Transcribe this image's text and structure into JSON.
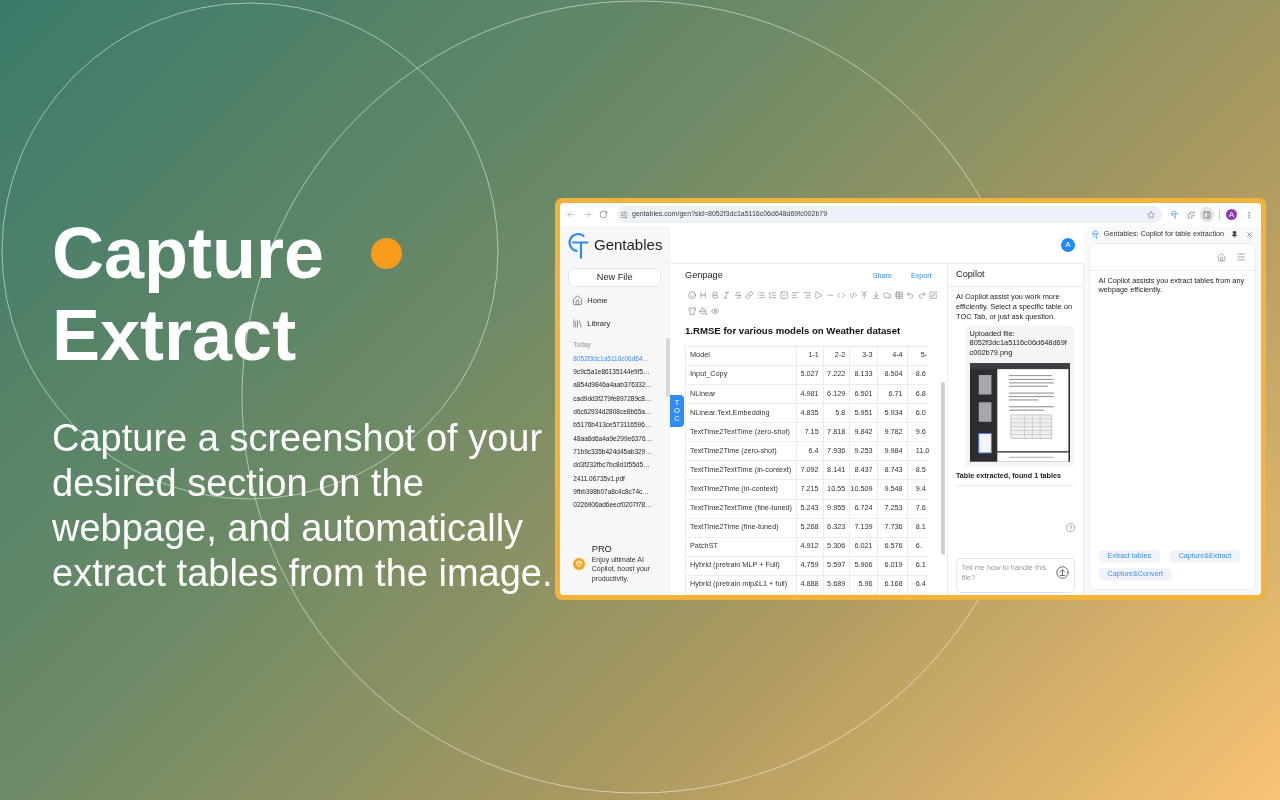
{
  "hero": {
    "title_lines": [
      "Capture",
      "Extract"
    ],
    "description": "Capture a screenshot of your desired section on the webpage, and automatically extract tables from the image."
  },
  "browser": {
    "url": "gentables.com/gen?sid=8052f3dc1a5116c06d648d69fc002b79",
    "profile_initial": "A"
  },
  "sidebar": {
    "logo_text": "Gentables",
    "new_file": "New File",
    "nav": [
      {
        "label": "Home"
      },
      {
        "label": "Library"
      }
    ],
    "history_heading": "Today",
    "history": [
      {
        "label": "8052f3dc1a5116c06d64…",
        "selected": true
      },
      {
        "label": "9c9c5a1e86135144e9f5…",
        "selected": false
      },
      {
        "label": "a854d9846a4aab376332…",
        "selected": false
      },
      {
        "label": "cad9dd3f279fe897289c8…",
        "selected": false
      },
      {
        "label": "d6c62934d2808ce8b65a…",
        "selected": false
      },
      {
        "label": "b5176b413ce573116596…",
        "selected": false
      },
      {
        "label": "48aa6d6a4a9e299e6376…",
        "selected": false
      },
      {
        "label": "71b9c335b424d45ab329…",
        "selected": false
      },
      {
        "label": "dd3f232fbc7bc8d1f55d5…",
        "selected": false
      },
      {
        "label": "2411.06735v1.pdf",
        "selected": false
      },
      {
        "label": "9fbb398b07a8c4c8c74c…",
        "selected": false
      },
      {
        "label": "0226906ad6eecf0207f78…",
        "selected": false
      }
    ],
    "pro": {
      "title": "PRO",
      "description": "Enjoy ultimate AI Copilot, boost your productivity."
    }
  },
  "header": {
    "avatar_initial": "A"
  },
  "toc_tab": "TOC",
  "editor": {
    "title": "Genpage",
    "actions": [
      "Share",
      "Export"
    ],
    "heading": "1.RMSE for various models on Weather dataset",
    "table": {
      "columns": [
        "Model",
        "1-1",
        "2-2",
        "3-3",
        "4-4",
        "5-"
      ],
      "rows": [
        [
          "Input_Copy",
          "5.027",
          "7.222",
          "8.133",
          "8.504",
          "8.6"
        ],
        [
          "NLinear",
          "4.981",
          "6.129",
          "6.501",
          "6.71",
          "6.8"
        ],
        [
          "NLinear.Text.Embedding",
          "4.835",
          "5.8",
          "5.951",
          "5.934",
          "6.0"
        ],
        [
          "TextTime2TextTime (zero-shot)",
          "7.15",
          "7.818",
          "9.842",
          "9.782",
          "9.6"
        ],
        [
          "TextTime2Time (zero-shot)",
          "6.4",
          "7.936",
          "9.253",
          "9.984",
          "11.0"
        ],
        [
          "TextTime2TextTime (in-context)",
          "7.092",
          "8.141",
          "8.437",
          "8.743",
          "8.5"
        ],
        [
          "TextTime2Time (in-context)",
          "7.215",
          "10.55",
          "10.509",
          "9.548",
          "9.4"
        ],
        [
          "TextTime2TextTime (fine-tuned)",
          "5.243",
          "9.955",
          "6.724",
          "7.253",
          "7.6"
        ],
        [
          "TextTime2Time (fine-tuned)",
          "5.268",
          "6.323",
          "7.139",
          "7.736",
          "8.1"
        ],
        [
          "PatchST",
          "4.912",
          "5.306",
          "6.021",
          "6.576",
          "6."
        ],
        [
          "Hybrid (pretrain MLP + Full)",
          "4.759",
          "5.597",
          "5.906",
          "6.019",
          "6.1"
        ],
        [
          "Hybrid (pretrain mlp&L1 + full)",
          "4.888",
          "5.689",
          "5.96",
          "6.168",
          "6.4"
        ]
      ]
    }
  },
  "copilot": {
    "title": "Copilot",
    "intro": "AI Copilot assist you work more efficiently. Select a specific table on TOC Tab, or just ask question.",
    "upload_label": "Uploaded file:",
    "file_name": "8052f3dc1a5116c06d648d69fc002b79.png",
    "status": "Table extracted, found 1 tables",
    "input": {
      "placeholder": "Tell me how to handle this file?"
    }
  },
  "side_panel": {
    "title": "Gentables: Copilot for table extraction",
    "message": "AI Copilot assists you extract tables from any webpage efficiently.",
    "quick_actions": [
      "Extract tables",
      "Capture&Extract",
      "Capture&Convert"
    ]
  }
}
